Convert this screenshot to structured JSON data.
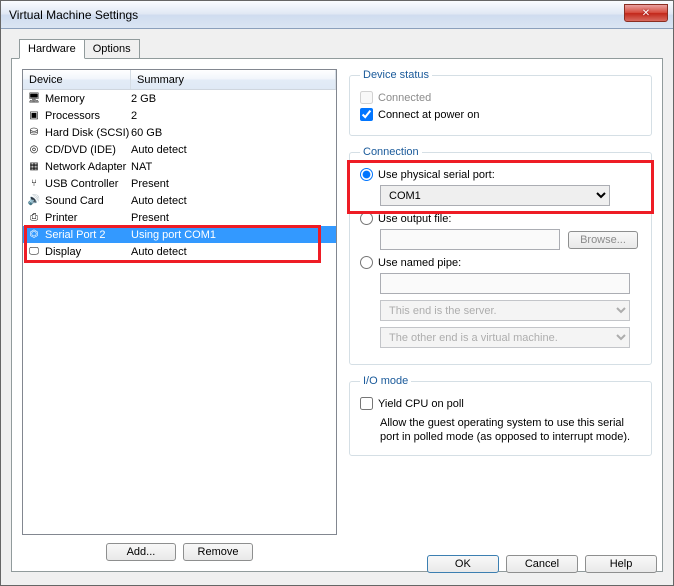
{
  "title": "Virtual Machine Settings",
  "tabs": {
    "hardware": "Hardware",
    "options": "Options"
  },
  "list": {
    "headers": {
      "device": "Device",
      "summary": "Summary"
    },
    "items": [
      {
        "name": "Memory",
        "summary": "2 GB",
        "icon": "🖥"
      },
      {
        "name": "Processors",
        "summary": "2",
        "icon": "▣"
      },
      {
        "name": "Hard Disk (SCSI)",
        "summary": "60 GB",
        "icon": "⛁"
      },
      {
        "name": "CD/DVD (IDE)",
        "summary": "Auto detect",
        "icon": "◎"
      },
      {
        "name": "Network Adapter",
        "summary": "NAT",
        "icon": "▦"
      },
      {
        "name": "USB Controller",
        "summary": "Present",
        "icon": "⑂"
      },
      {
        "name": "Sound Card",
        "summary": "Auto detect",
        "icon": "🔊"
      },
      {
        "name": "Printer",
        "summary": "Present",
        "icon": "⎙"
      },
      {
        "name": "Serial Port 2",
        "summary": "Using port COM1",
        "icon": "⏣"
      },
      {
        "name": "Display",
        "summary": "Auto detect",
        "icon": "🖵"
      }
    ],
    "selectedIndex": 8
  },
  "leftButtons": {
    "add": "Add...",
    "remove": "Remove"
  },
  "deviceStatus": {
    "legend": "Device status",
    "connected": "Connected",
    "connectAtPowerOn": "Connect at power on",
    "connectedChecked": false,
    "connectAtPowerOnChecked": true
  },
  "connection": {
    "legend": "Connection",
    "usePhysical": "Use physical serial port:",
    "physicalValue": "COM1",
    "useOutputFile": "Use output file:",
    "browse": "Browse...",
    "useNamedPipe": "Use named pipe:",
    "pipeEnd1": "This end is the server.",
    "pipeEnd2": "The other end is a virtual machine.",
    "selected": "physical"
  },
  "ioMode": {
    "legend": "I/O mode",
    "yield": "Yield CPU on poll",
    "note": "Allow the guest operating system to use this serial port in polled mode (as opposed to interrupt mode)."
  },
  "dialogButtons": {
    "ok": "OK",
    "cancel": "Cancel",
    "help": "Help"
  }
}
